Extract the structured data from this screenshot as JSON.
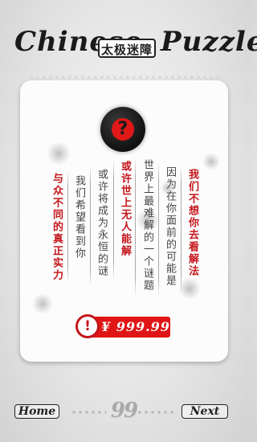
{
  "header": {
    "title_left": "Chinese",
    "title_seal": "太极迷障",
    "title_right": "Puzzle"
  },
  "card": {
    "question_glyph": "?",
    "columns": [
      {
        "text": "我们不想你去看解法",
        "style": "red"
      },
      {
        "text": "因为在你面前的可能是",
        "style": "normal"
      },
      {
        "text": "世界上最难解的一个谜题",
        "style": "normal"
      },
      {
        "text": "或许世上无人能解",
        "style": "red"
      },
      {
        "text": "或许将成为永恒的谜",
        "style": "normal"
      },
      {
        "text": "我们希望看到你",
        "style": "normal"
      },
      {
        "text": "与众不同的真正实力",
        "style": "red"
      }
    ]
  },
  "price": {
    "icon": "!",
    "label": "¥ 999.99"
  },
  "footer": {
    "home_label": "Home",
    "next_label": "Next",
    "level_number": "99"
  },
  "colors": {
    "accent_red": "#e01515",
    "ink": "#1a1a1a",
    "card_bg": "#fcfcfc"
  }
}
